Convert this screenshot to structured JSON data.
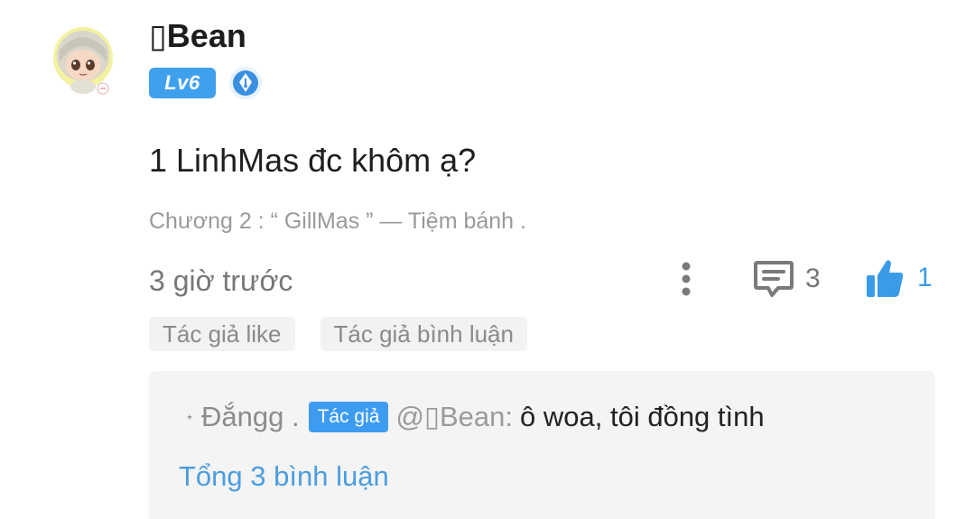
{
  "comment": {
    "username": "▯Bean",
    "level_badge": "Lv6",
    "avatar_icon": "chibi-avatar-icon",
    "author_badge_icon": "pen-nib-badge-icon",
    "text": "1 LinhMas đc khôm ạ?",
    "chapter": "Chương 2 : “ GillMas ” — Tiệm bánh .",
    "time": "3 giờ trước",
    "more_icon": "more-vertical-icon",
    "reply_icon": "comment-bubble-icon",
    "reply_count": "3",
    "like_icon": "thumbs-up-icon",
    "like_count": "1",
    "tags": [
      "Tác giả like",
      "Tác giả bình luận"
    ]
  },
  "reply_preview": {
    "star": "⋆",
    "replier": "Đắngg .",
    "author_tag": "Tác giả",
    "mention": "@▯Bean",
    "colon": ":",
    "content": "ô woa, tôi đồng tình",
    "total_link": "Tổng 3 bình luận"
  },
  "colors": {
    "accent": "#3fa0ee",
    "like": "#3a9be8",
    "link": "#4a9de0",
    "muted": "#8a8a8a",
    "reply_box_bg": "#f4f4f4"
  }
}
